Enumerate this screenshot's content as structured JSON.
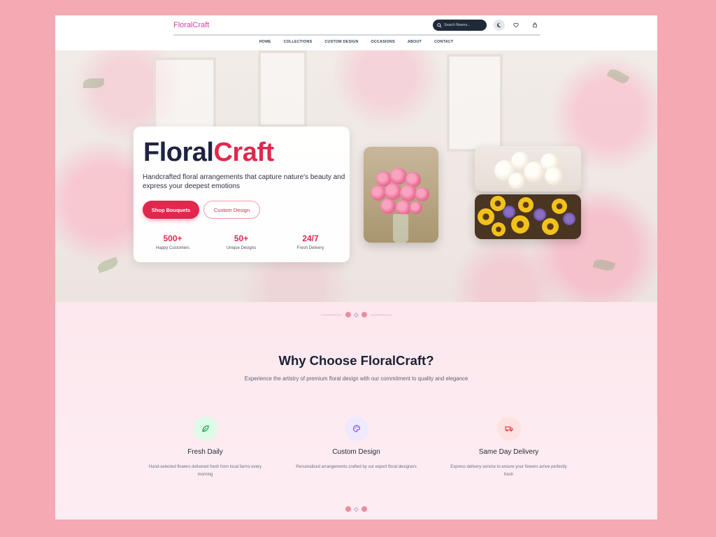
{
  "header": {
    "logo": "FloralCraft",
    "search_placeholder": "Search flowers...",
    "icons": [
      "moon-icon",
      "heart-icon",
      "bag-icon"
    ]
  },
  "nav": {
    "items": [
      "HOME",
      "COLLECTIONS",
      "CUSTOM DESIGN",
      "OCCASIONS",
      "ABOUT",
      "CONTACT"
    ]
  },
  "hero": {
    "title_part1": "Floral",
    "title_part2": "Craft",
    "subtitle": "Handcrafted floral arrangements that capture nature's beauty and express your deepest emotions",
    "primary_button": "Shop Bouquets",
    "secondary_button": "Custom Design",
    "stats": [
      {
        "value": "500+",
        "label": "Happy Customers"
      },
      {
        "value": "50+",
        "label": "Unique Designs"
      },
      {
        "value": "24/7",
        "label": "Fresh Delivery"
      }
    ]
  },
  "features": {
    "title": "Why Choose FloralCraft?",
    "subtitle": "Experience the artistry of premium floral design with our commitment to quality and elegance",
    "items": [
      {
        "title": "Fresh Daily",
        "description": "Hand-selected flowers delivered fresh from local farms every morning",
        "icon": "leaf-icon"
      },
      {
        "title": "Custom Design",
        "description": "Personalized arrangements crafted by our expert floral designers",
        "icon": "palette-icon"
      },
      {
        "title": "Same Day Delivery",
        "description": "Express delivery service to ensure your flowers arrive perfectly fresh",
        "icon": "truck-icon"
      }
    ]
  },
  "colors": {
    "accent": "#e0284e",
    "logo": "#d63da7",
    "page_bg": "#f4a9b3",
    "dark": "#1f2340"
  }
}
